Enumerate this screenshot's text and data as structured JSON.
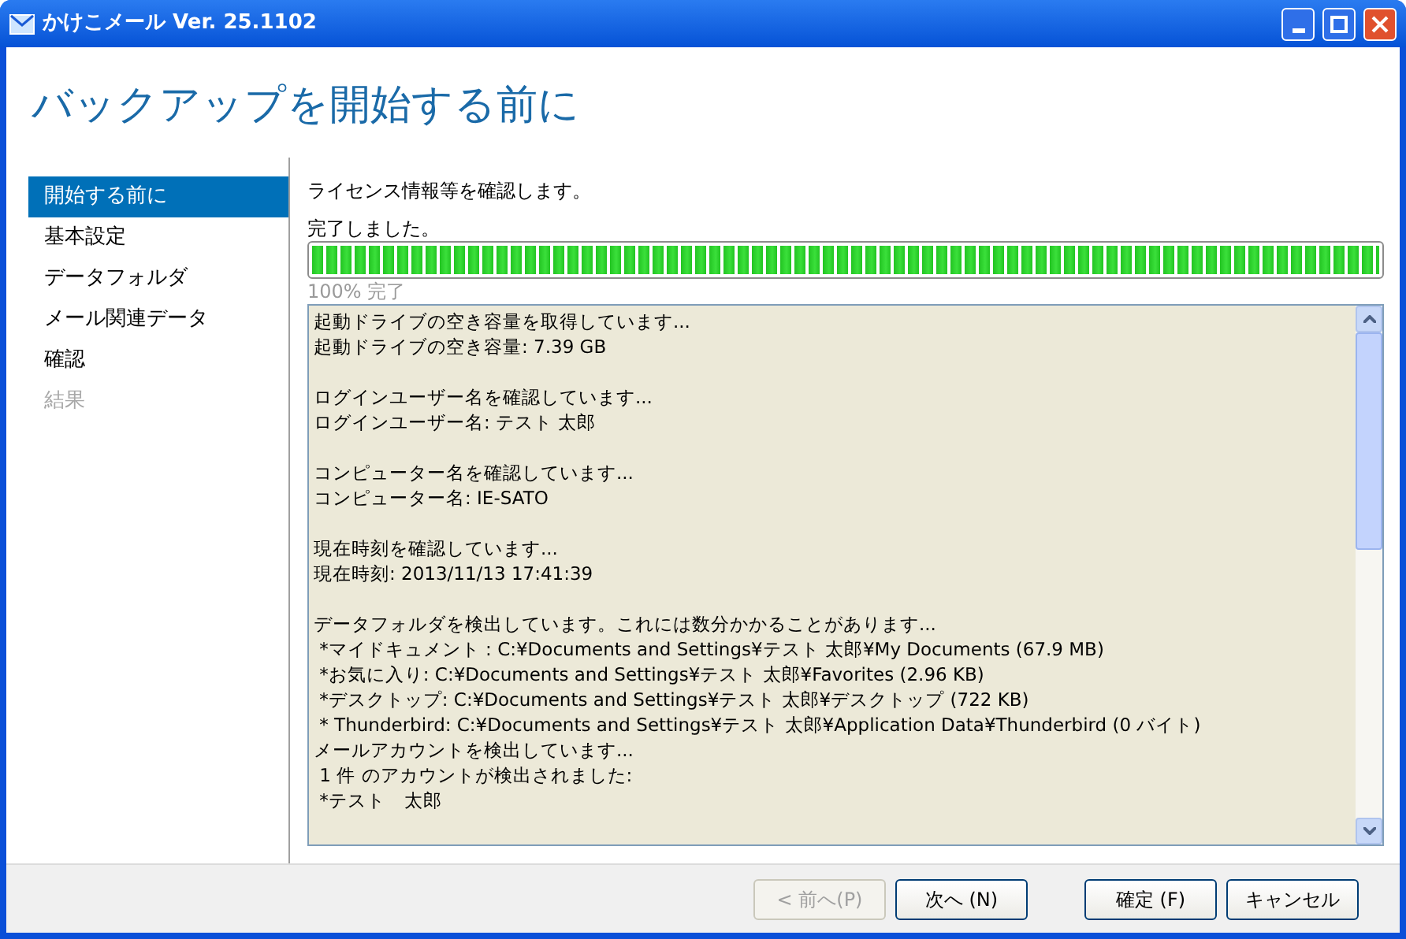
{
  "window": {
    "title": "かけこメール Ver. 25.1102"
  },
  "heading": "バックアップを開始する前に",
  "sidebar": {
    "items": [
      {
        "label": "開始する前に",
        "selected": true,
        "disabled": false
      },
      {
        "label": "基本設定",
        "selected": false,
        "disabled": false
      },
      {
        "label": "データフォルダ",
        "selected": false,
        "disabled": false
      },
      {
        "label": "メール関連データ",
        "selected": false,
        "disabled": false
      },
      {
        "label": "確認",
        "selected": false,
        "disabled": false
      },
      {
        "label": "結果",
        "selected": false,
        "disabled": true
      }
    ]
  },
  "description": "ライセンス情報等を確認します。",
  "status": "完了しました。",
  "progress": {
    "level": 1,
    "reading": "100% 完了"
  },
  "log": [
    [
      "起動ドライブの空き容量を取得しています...",
      "起動ドライブの空き容量: 7.39 GB"
    ],
    [
      "ログインユーザー名を確認しています...",
      "ログインユーザー名: テスト 太郎"
    ],
    [
      "コンピューター名を確認しています...",
      "コンピューター名: IE-SATO"
    ],
    [
      "現在時刻を確認しています...",
      "現在時刻: 2013/11/13 17:41:39"
    ],
    [
      "データフォルダを検出しています。これには数分かかることがあります...",
      " *マイドキュメント : C:¥Documents and Settings¥テスト 太郎¥My Documents (67.9 MB)",
      " *お気に入り: C:¥Documents and Settings¥テスト 太郎¥Favorites (2.96 KB)",
      " *デスクトップ: C:¥Documents and Settings¥テスト 太郎¥デスクトップ (722 KB)",
      " * Thunderbird: C:¥Documents and Settings¥テスト 太郎¥Application Data¥Thunderbird (0 バイト)",
      "メールアカウントを検出しています...",
      " 1 件 のアカウントが検出されました:",
      " *テスト　太郎"
    ]
  ],
  "buttons": [
    {
      "label": "< 前へ(P)",
      "disabled": true
    },
    {
      "label": "次へ (N)",
      "disabled": false
    },
    {
      "label": "確定 (F)",
      "disabled": false
    },
    {
      "label": "キャンセル",
      "disabled": false
    }
  ]
}
